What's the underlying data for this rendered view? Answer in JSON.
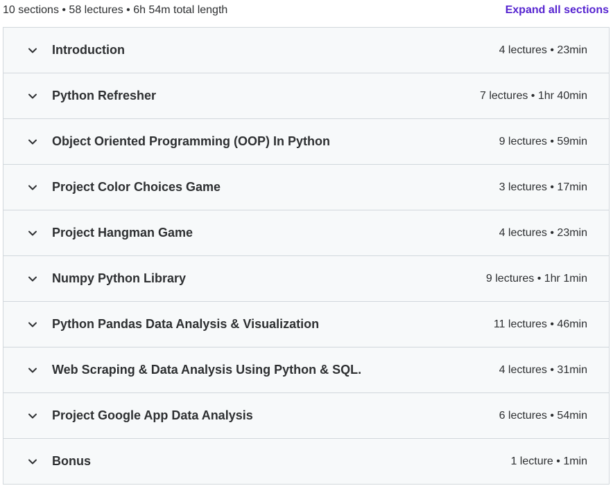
{
  "curriculum": {
    "summary": "10 sections • 58 lectures • 6h 54m total length",
    "expand_all_label": "Expand all sections",
    "sections": [
      {
        "title": "Introduction",
        "meta": "4 lectures • 23min"
      },
      {
        "title": "Python Refresher",
        "meta": "7 lectures • 1hr 40min"
      },
      {
        "title": "Object Oriented Programming (OOP) In Python",
        "meta": "9 lectures • 59min"
      },
      {
        "title": "Project Color Choices Game",
        "meta": "3 lectures • 17min"
      },
      {
        "title": "Project Hangman Game",
        "meta": "4 lectures • 23min"
      },
      {
        "title": "Numpy Python Library",
        "meta": "9 lectures • 1hr 1min"
      },
      {
        "title": "Python Pandas Data Analysis & Visualization",
        "meta": "11 lectures • 46min"
      },
      {
        "title": "Web Scraping & Data Analysis Using Python & SQL.",
        "meta": "4 lectures • 31min"
      },
      {
        "title": "Project Google App Data Analysis",
        "meta": "6 lectures • 54min"
      },
      {
        "title": "Bonus",
        "meta": "1 lecture • 1min"
      }
    ]
  },
  "icons": {
    "section_toggle": "chevron-down-icon"
  },
  "colors": {
    "accent": "#5624d0",
    "section_bg": "#f7f9fa",
    "border": "#d1d7dc",
    "text": "#2d2f31"
  }
}
